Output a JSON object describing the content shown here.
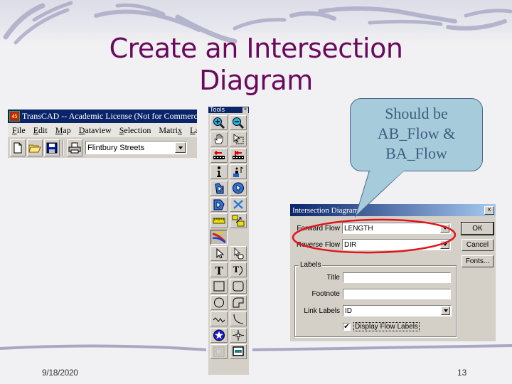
{
  "slide": {
    "title_line1": "Create an Intersection",
    "title_line2": "Diagram",
    "date": "9/18/2020",
    "page_number": "13"
  },
  "callout": {
    "line1": "Should be",
    "line2": "AB_Flow &",
    "line3": "BA_Flow"
  },
  "transcad": {
    "title": "TransCAD -- Academic License (Not for Commercial",
    "app_icon_text": "45",
    "menu": [
      {
        "key": "F",
        "rest": "ile"
      },
      {
        "key": "E",
        "rest": "dit"
      },
      {
        "key": "M",
        "rest": "ap"
      },
      {
        "key": "D",
        "rest": "ataview"
      },
      {
        "key": "S",
        "rest": "election"
      },
      {
        "pre": "Matri",
        "key": "x",
        "rest": ""
      },
      {
        "key": "L",
        "rest": "ay"
      }
    ],
    "toolbar": {
      "new_icon": "new-file-icon",
      "open_icon": "open-folder-icon",
      "save_icon": "save-disk-icon",
      "print_icon": "printer-icon",
      "layer_select_value": "Flintbury Streets"
    }
  },
  "tools_palette": {
    "title": "Tools",
    "close": "×",
    "tools": [
      "zoom-in-icon",
      "zoom-out-icon",
      "pan-hand-icon",
      "select-area-icon",
      "route-back-icon",
      "route-end-icon",
      "info-icon",
      "hotlink-icon",
      "pointer-select-icon",
      "circle-select-icon",
      "polygon-select-icon",
      "delete-node-icon",
      "ruler-icon",
      "scale-icon",
      "intersection-diagram-icon",
      "",
      "arrow-pointer-icon",
      "pointer-hand-icon",
      "text-icon",
      "curved-text-icon",
      "rectangle-icon",
      "rounded-rectangle-icon",
      "ellipse-icon",
      "freehand-shape-icon",
      "polyline-icon",
      "arc-icon",
      "star-symbol-icon",
      "north-arrow-icon",
      "frame-icon",
      "legend-icon"
    ]
  },
  "dialog": {
    "title": "Intersection Diagram",
    "close": "×",
    "forward_flow_label": "Forward Flow",
    "forward_flow_value": "LENGTH",
    "reverse_flow_label": "Reverse Flow",
    "reverse_flow_value": "DIR",
    "labels_group": "Labels",
    "title_label": "Title",
    "title_value": "",
    "footnote_label": "Footnote",
    "footnote_value": "",
    "link_labels_label": "Link Labels",
    "link_labels_value": "ID",
    "display_flow_labels": "Display Flow Labels",
    "display_flow_labels_checked": true,
    "ok_button": "OK",
    "cancel_button": "Cancel",
    "fonts_button": "Fonts..."
  },
  "colors": {
    "title": "#6a0a5e",
    "callout_fill": "#a6cbdb",
    "callout_text": "#3e5c7e",
    "highlight_ellipse": "#e0161e",
    "win_titlebar": "#0a246a"
  }
}
